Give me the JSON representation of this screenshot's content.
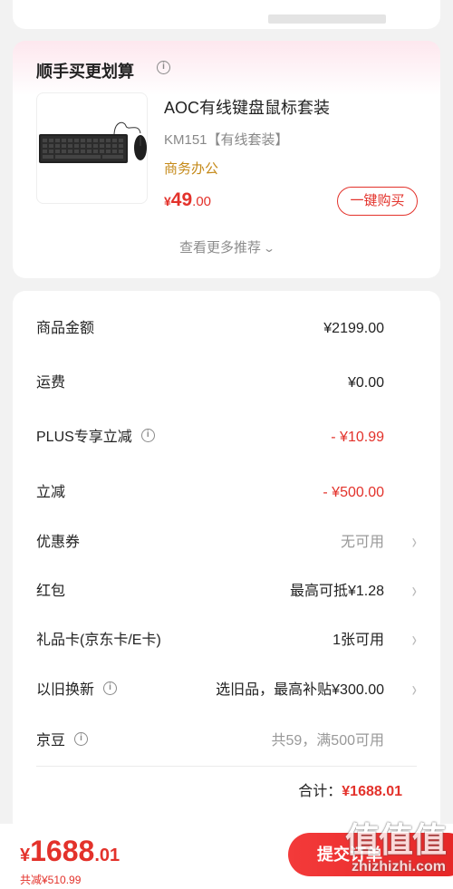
{
  "recommend": {
    "title": "顺手买更划算",
    "info_icon": "info-circle-icon",
    "product": {
      "name": "AOC有线键盘鼠标套装",
      "spec": "KM151【有线套装】",
      "tag": "商务办公",
      "price_currency": "¥",
      "price_int": "49",
      "price_dec": ".00",
      "buy_label": "一键购买"
    },
    "more_label": "查看更多推荐",
    "more_icon": "chevron-down-icon"
  },
  "summary": {
    "rows": [
      {
        "label": "商品金额",
        "value": "¥2199.00"
      },
      {
        "label": "运费",
        "value": "¥0.00"
      },
      {
        "label": "PLUS专享立减",
        "value": "- ¥10.99"
      },
      {
        "label": "立减",
        "value": "- ¥500.00"
      },
      {
        "label": "优惠券",
        "value": "无可用"
      },
      {
        "label": "红包",
        "value": "最高可抵¥1.28"
      },
      {
        "label": "礼品卡(京东卡/E卡)",
        "value": "1张可用"
      },
      {
        "label": "以旧换新",
        "value": "选旧品，最高补贴¥300.00"
      },
      {
        "label": "京豆",
        "value": "共59，满500可用"
      }
    ],
    "total_label": "合计：",
    "total_value": "¥1688.01"
  },
  "bottom": {
    "price_currency": "¥",
    "price_int": "1688",
    "price_dec": ".01",
    "saved": "共减¥510.99",
    "submit_label": "提交订单"
  },
  "watermark": {
    "logo": "值值值",
    "site": "zhizhizhi.com"
  },
  "colors": {
    "accent_red": "#e3322b",
    "tag_gold": "#c58a1a",
    "background": "#f2f2f2"
  }
}
